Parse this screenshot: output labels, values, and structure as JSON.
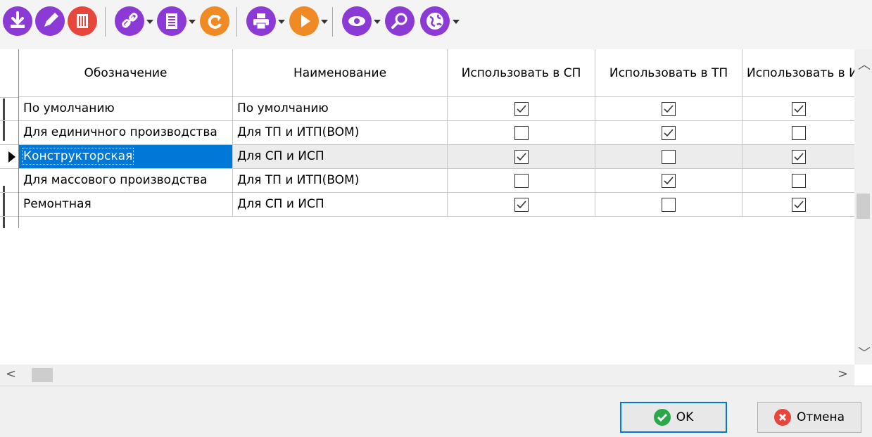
{
  "toolbar": {
    "buttons": [
      {
        "icon": "download-icon",
        "color": "#8b3ad6"
      },
      {
        "icon": "edit-icon",
        "color": "#8b3ad6"
      },
      {
        "icon": "delete-icon",
        "color": "#e8453c"
      },
      {
        "icon": "link-icon",
        "color": "#8b3ad6"
      },
      {
        "icon": "document-icon",
        "color": "#8b3ad6"
      },
      {
        "icon": "refresh-icon",
        "color": "#f08a24"
      },
      {
        "icon": "print-icon",
        "color": "#8b3ad6"
      },
      {
        "icon": "play-icon",
        "color": "#f08a24"
      },
      {
        "icon": "eye-icon",
        "color": "#8b3ad6"
      },
      {
        "icon": "search-icon",
        "color": "#8b3ad6"
      },
      {
        "icon": "globe-icon",
        "color": "#8b3ad6"
      }
    ]
  },
  "grid": {
    "columns": [
      "Обозначение",
      "Наименование",
      "Использовать в СП",
      "Использовать в ТП",
      "Использовать в ИСП"
    ],
    "rows": [
      {
        "designation": "По умолчанию",
        "name": "По умолчанию",
        "sp": true,
        "tp": true,
        "isp": true
      },
      {
        "designation": "Для единичного производства",
        "name": "Для ТП и ИТП(BOM)",
        "sp": false,
        "tp": true,
        "isp": false
      },
      {
        "designation": "Конструкторская",
        "name": "Для СП и ИСП",
        "sp": true,
        "tp": false,
        "isp": true,
        "selected": true
      },
      {
        "designation": "Для массового производства",
        "name": "Для ТП и ИТП(BOM)",
        "sp": false,
        "tp": true,
        "isp": false
      },
      {
        "designation": "Ремонтная",
        "name": "Для СП и ИСП",
        "sp": true,
        "tp": false,
        "isp": true
      }
    ]
  },
  "footer": {
    "ok_label": "OK",
    "cancel_label": "Отмена"
  },
  "colors": {
    "accent": "#0078d7",
    "purple": "#8b3ad6",
    "orange": "#f08a24",
    "red": "#e8453c",
    "ok_green": "#2aa84a"
  }
}
